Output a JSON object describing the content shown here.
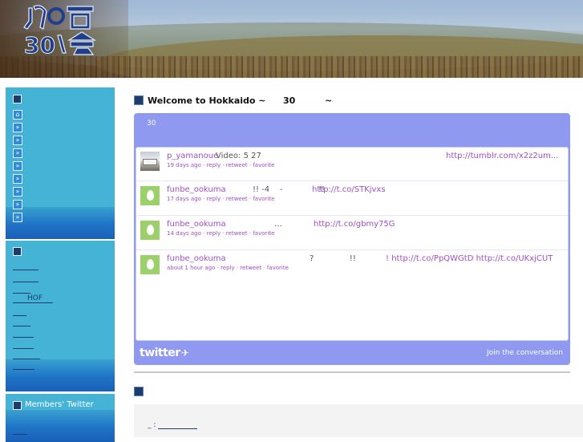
{
  "header": {
    "logo_text": "北の宿30人会"
  },
  "sidebar": {
    "box1": {
      "nav_icons": [
        "home-icon",
        "arrow-right-icon",
        "arrow-right-icon",
        "arrow-right-icon",
        "arrow-right-icon",
        "arrow-right-icon",
        "arrow-right-icon",
        "arrow-right-icon",
        "arrow-right-icon"
      ]
    },
    "box2": {
      "links": [
        "",
        "",
        "",
        "HOF",
        "",
        "",
        "",
        "",
        "",
        ""
      ]
    },
    "box3": {
      "title": "Members' Twitter"
    }
  },
  "main": {
    "welcome": {
      "prefix": "Welcome to Hokkaido ~",
      "number": "30",
      "suffix": "~"
    },
    "widget": {
      "subtitle": "30",
      "tweets": [
        {
          "user": "p_yamanoue",
          "text": "Video: 5 27",
          "links": "http://tumblr.com/x2z2um...",
          "meta": "19 days ago · reply · retweet · favorite",
          "avatar": "photo"
        },
        {
          "user": "funbe_ookuma",
          "text": "!! -4    -              !!",
          "links": "http://t.co/STKjvxs",
          "meta": "17 days ago · reply · retweet · favorite",
          "avatar": "egg"
        },
        {
          "user": "funbe_ookuma",
          "text": "…",
          "links": "http://t.co/gbmy75G",
          "meta": "14 days ago · reply · retweet · favorite",
          "avatar": "egg"
        },
        {
          "user": "funbe_ookuma",
          "text": "?              !!",
          "links": "! http://t.co/PpQWGtD http://t.co/UKxjCUT",
          "meta": "about 1 hour ago · reply · retweet · favorite",
          "avatar": "egg"
        }
      ],
      "brand": "twitter",
      "join_label": "Join the conversation"
    },
    "section2": {
      "text": "_ :"
    }
  },
  "colors": {
    "sidebar": "#45b3d6",
    "widget": "#8f99f0",
    "link": "#a04fc4",
    "navy": "#1d3c6e"
  }
}
